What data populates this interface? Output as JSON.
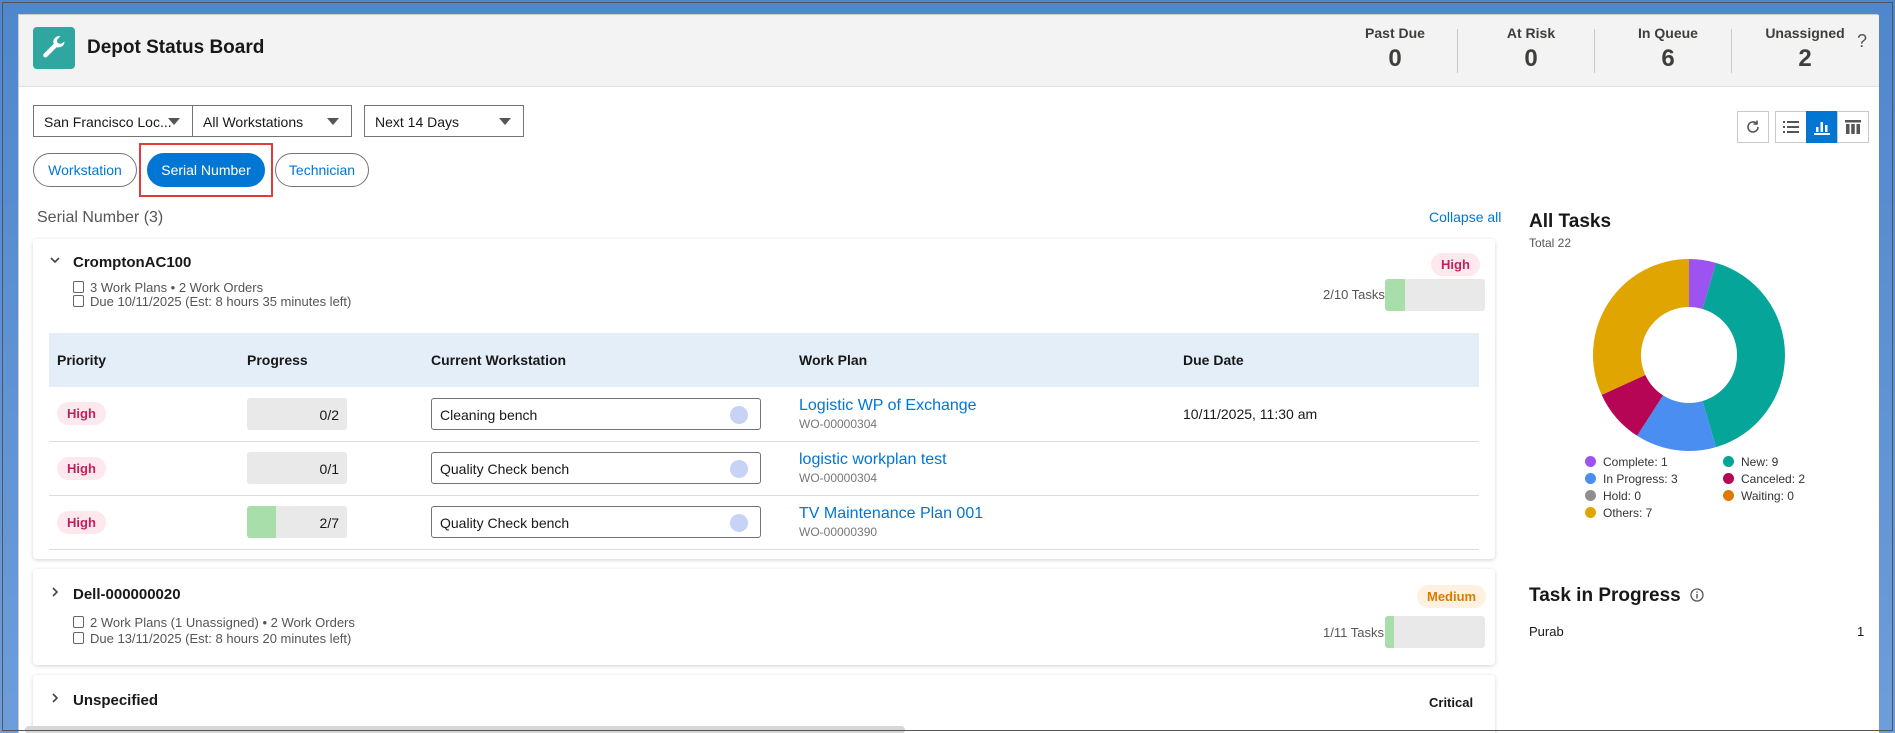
{
  "header": {
    "title": "Depot Status Board",
    "stats": [
      {
        "label": "Past Due",
        "value": "0"
      },
      {
        "label": "At Risk",
        "value": "0"
      },
      {
        "label": "In Queue",
        "value": "6"
      },
      {
        "label": "Unassigned",
        "value": "2"
      }
    ],
    "help": "?"
  },
  "filters": {
    "location": "San Francisco Loc...",
    "workstation": "All Workstations",
    "range": "Next 14 Days"
  },
  "view_icons": [
    "refresh-icon",
    "list-view-icon",
    "chart-view-icon",
    "board-view-icon"
  ],
  "group_tabs": [
    {
      "label": "Workstation",
      "active": false
    },
    {
      "label": "Serial Number",
      "active": true
    },
    {
      "label": "Technician",
      "active": false
    }
  ],
  "section": {
    "title": "Serial Number (3)",
    "collapse_all": "Collapse all"
  },
  "table_headers": [
    "Priority",
    "Progress",
    "Current Workstation",
    "Work Plan",
    "Due Date"
  ],
  "groups": [
    {
      "name": "CromptonAC100",
      "priority": "High",
      "meta1": "3 Work Plans • 2 Work Orders",
      "meta2": "Due 10/11/2025 (Est: 8 hours 35 minutes left)",
      "tasks_label": "2/10 Tasks",
      "tasks_fraction": 0.2,
      "rows": [
        {
          "priority": "High",
          "progress": "0/2",
          "progress_fraction": 0,
          "workstation": "Cleaning bench",
          "work_plan": "Logistic WP of Exchange",
          "work_order": "WO-00000304",
          "due": "10/11/2025, 11:30 am"
        },
        {
          "priority": "High",
          "progress": "0/1",
          "progress_fraction": 0,
          "workstation": "Quality Check bench",
          "work_plan": "logistic workplan test",
          "work_order": "WO-00000304",
          "due": ""
        },
        {
          "priority": "High",
          "progress": "2/7",
          "progress_fraction": 0.2857,
          "workstation": "Quality Check bench",
          "work_plan": "TV Maintenance Plan 001",
          "work_order": "WO-00000390",
          "due": ""
        }
      ]
    },
    {
      "name": "Dell-000000020",
      "priority": "Medium",
      "meta1": "2 Work Plans (1 Unassigned) • 2 Work Orders",
      "meta2": "Due 13/11/2025 (Est: 8 hours 20 minutes left)",
      "tasks_label": "1/11 Tasks",
      "tasks_fraction": 0.09
    },
    {
      "name": "Unspecified",
      "priority": "Critical"
    }
  ],
  "all_tasks": {
    "title": "All Tasks",
    "total": "Total 22",
    "legend": [
      {
        "label": "Complete: 1",
        "color": "#9d53f2"
      },
      {
        "label": "New: 9",
        "color": "#06a59a"
      },
      {
        "label": "In Progress: 3",
        "color": "#4b8ef1"
      },
      {
        "label": "Canceled: 2",
        "color": "#b60554"
      },
      {
        "label": "Hold: 0",
        "color": "#8e8e8e"
      },
      {
        "label": "Waiting: 0",
        "color": "#dd7a01"
      },
      {
        "label": "Others: 7",
        "color": "#e0a500"
      }
    ]
  },
  "chart_data": {
    "type": "pie",
    "title": "All Tasks",
    "categories": [
      "Complete",
      "New",
      "In Progress",
      "Canceled",
      "Hold",
      "Waiting",
      "Others"
    ],
    "values": [
      1,
      9,
      3,
      2,
      0,
      0,
      7
    ],
    "colors": [
      "#9d53f2",
      "#06a59a",
      "#4b8ef1",
      "#b60554",
      "#8e8e8e",
      "#dd7a01",
      "#e0a500"
    ],
    "legend": "bottom"
  },
  "task_in_progress": {
    "title": "Task in Progress",
    "rows": [
      {
        "name": "Purab",
        "value": "1"
      }
    ]
  }
}
